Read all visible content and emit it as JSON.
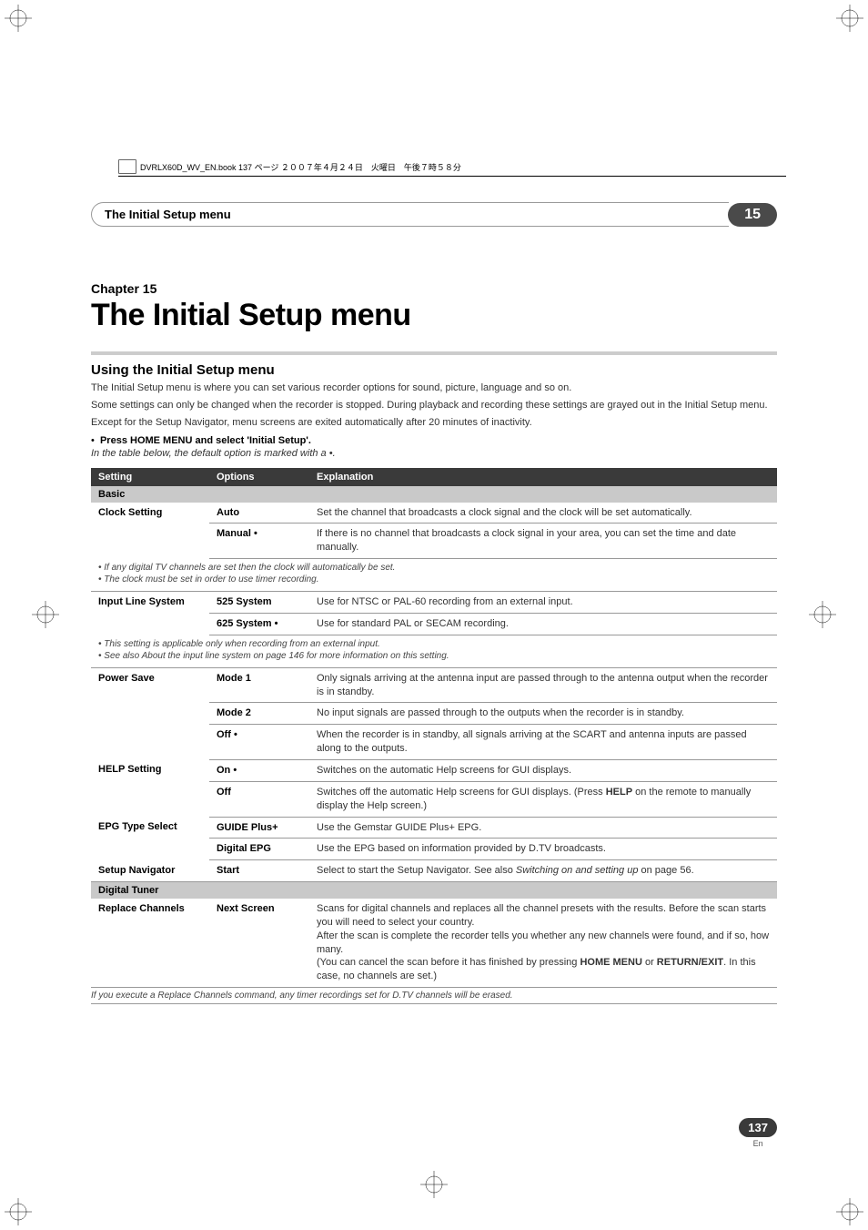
{
  "print_header": "DVRLX60D_WV_EN.book 137 ページ ２００７年４月２４日　火曜日　午後７時５８分",
  "tab": {
    "title": "The Initial Setup menu",
    "number": "15"
  },
  "chapter": {
    "label": "Chapter 15",
    "title": "The Initial Setup menu"
  },
  "section": "Using the Initial Setup menu",
  "intro": [
    "The Initial Setup menu is where you can set various recorder options for sound, picture, language and so on.",
    "Some settings can only be changed when the recorder is stopped. During playback and recording these settings are grayed out in the Initial Setup menu.",
    "Except for the Setup Navigator, menu screens are exited automatically after 20 minutes of inactivity."
  ],
  "bullet": "Press HOME MENU and select 'Initial Setup'.",
  "bullet_note": "In the table below, the default option is marked with a •.",
  "headers": {
    "setting": "Setting",
    "options": "Options",
    "explanation": "Explanation"
  },
  "subheads": {
    "basic": "Basic",
    "digital_tuner": "Digital Tuner"
  },
  "rows": {
    "clock_setting": {
      "label": "Clock Setting",
      "auto": {
        "opt": "Auto",
        "exp": "Set the channel that broadcasts a clock signal and the clock will be set automatically."
      },
      "manual": {
        "opt": "Manual •",
        "exp": "If there is no channel that broadcasts a clock signal in your area, you can set the time and date manually."
      }
    },
    "clock_note": "• If any digital TV channels are set then the clock will automatically be set.\n• The clock must be set in order to use timer recording.",
    "input_line": {
      "label": "Input Line System",
      "s525": {
        "opt": "525 System",
        "exp": "Use for NTSC or PAL-60 recording from an external input."
      },
      "s625": {
        "opt": "625 System •",
        "exp": "Use for standard PAL or SECAM recording."
      }
    },
    "input_note": "• This setting is applicable only when recording from an external input.\n• See also About the input line system on page 146 for more information on this setting.",
    "power_save": {
      "label": "Power Save",
      "m1": {
        "opt": "Mode 1",
        "exp": "Only signals arriving at the antenna input are passed through to the antenna output when the recorder is in standby."
      },
      "m2": {
        "opt": "Mode 2",
        "exp": "No input signals are passed through to the outputs when the recorder is in standby."
      },
      "off": {
        "opt": "Off •",
        "exp": "When the recorder is in standby, all signals arriving at the SCART and antenna inputs are passed along to the outputs."
      }
    },
    "help": {
      "label": "HELP Setting",
      "on": {
        "opt": "On •",
        "exp": "Switches on the automatic Help screens for GUI displays."
      },
      "off": {
        "opt": "Off",
        "exp_pre": "Switches off the automatic Help screens for GUI displays. (Press ",
        "exp_b": "HELP",
        "exp_post": " on the remote to manually display the Help screen.)"
      }
    },
    "epg": {
      "label": "EPG Type Select",
      "guide": {
        "opt": "GUIDE Plus+",
        "exp": "Use the Gemstar GUIDE Plus+ EPG."
      },
      "digital": {
        "opt": "Digital EPG",
        "exp": "Use the EPG based on information provided by D.TV broadcasts."
      }
    },
    "setup_nav": {
      "label": "Setup Navigator",
      "start": {
        "opt": "Start",
        "exp_pre": "Select to start the Setup Navigator. See also ",
        "exp_i": "Switching on and setting up",
        "exp_post": " on page 56."
      }
    },
    "replace": {
      "label": "Replace Channels",
      "next": {
        "opt": "Next Screen",
        "exp_1": "Scans for digital channels and replaces all the channel presets with the results. Before the scan starts you will need to select your country.",
        "exp_2": "After the scan is complete the recorder tells you whether any new channels were found, and if so, how many.",
        "exp_3a": "(You can cancel the scan before it has finished by pressing ",
        "exp_3b1": "HOME MENU",
        "exp_3c": " or ",
        "exp_3b2": "RETURN/EXIT",
        "exp_3d": ". In this case, no channels are set.)"
      }
    }
  },
  "foot_note": "If you execute a Replace Channels command, any timer recordings set for D.TV channels will be erased.",
  "page": {
    "num": "137",
    "lang": "En"
  }
}
